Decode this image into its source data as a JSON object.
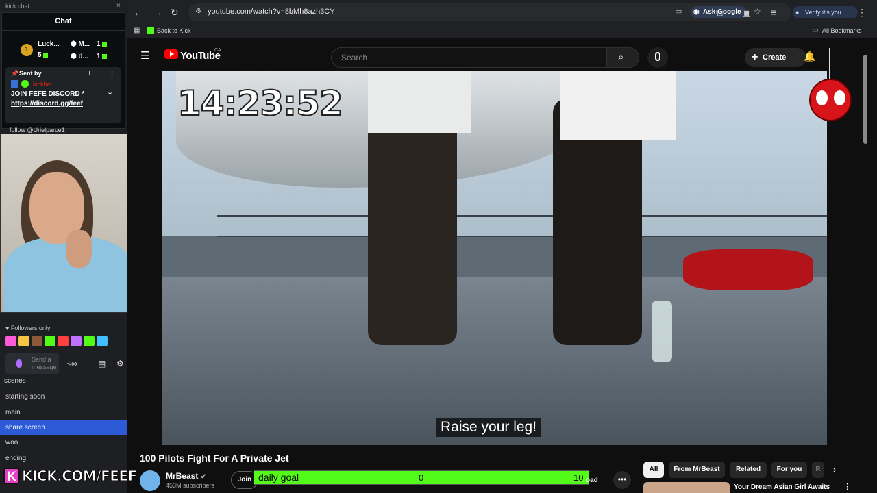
{
  "kick_chat": {
    "window_title": "kick chat",
    "close_icon": "×",
    "header": "Chat",
    "leaderboard": [
      {
        "rank": "1",
        "name": "Luck...",
        "count": "5"
      },
      {
        "name": "M...",
        "count": "1"
      },
      {
        "name": "d...",
        "count": "1"
      }
    ],
    "pinned": {
      "sent_by": "Sent by",
      "user": "kickbot",
      "message": "JOIN FEFE DISCORD *",
      "link": "https://discord.gg/feef"
    },
    "chat_line": "follow @Urielparce1",
    "followers_only": "Followers only",
    "input_placeholder": "Send a message",
    "emote_colors": [
      "#ff5ad8",
      "#f4c542",
      "#8a5a3a",
      "#53fc18",
      "#ff4040",
      "#c070ff",
      "#53fc18",
      "#40c0ff"
    ]
  },
  "obs": {
    "scenes_label": "scenes",
    "scenes": [
      "starting soon",
      "main",
      "share screen",
      "woo",
      "ending"
    ],
    "active_scene": "share screen"
  },
  "overlay": {
    "kick_k": "K",
    "kick_url": "KICK.COM/FEEF"
  },
  "browser": {
    "url": "youtube.com/watch?v=8bMh8azh3CY",
    "ask_google": "Ask Google",
    "verify": "Verify it's you",
    "back_to_kick": "Back to Kick",
    "all_bookmarks": "All Bookmarks"
  },
  "youtube": {
    "wordmark": "YouTube",
    "country": "CA",
    "search_placeholder": "Search",
    "create_label": "Create",
    "video": {
      "timer": "14:23:52",
      "subtitle": "Raise your leg!"
    },
    "title": "100 Pilots Fight For A Private Jet",
    "channel": "MrBeast",
    "subscribers": "453M subscribers",
    "join_label": "Join",
    "download_fragment": "oad",
    "chips": [
      "All",
      "From MrBeast",
      "Related",
      "For you",
      "R"
    ],
    "active_chip": "All",
    "recommended_title": "Your Dream Asian Girl Awaits"
  },
  "goal": {
    "label": "daily goal",
    "current": "0",
    "target": "10",
    "progress": 1.0,
    "color": "#53fc18"
  }
}
